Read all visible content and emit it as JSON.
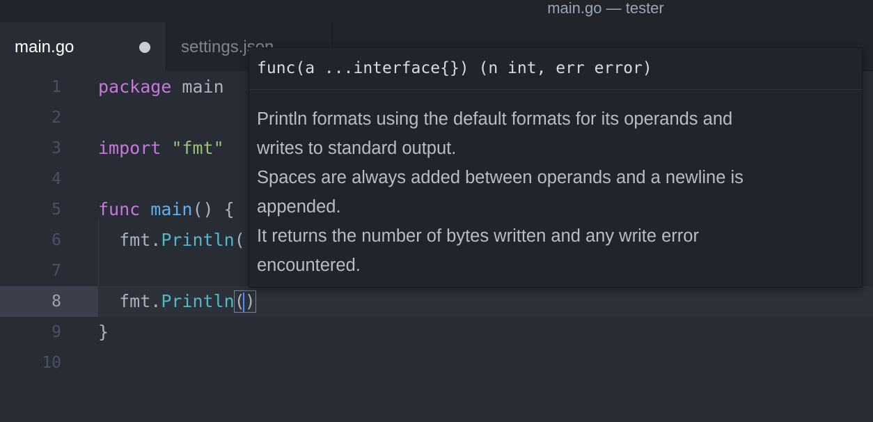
{
  "window": {
    "title": "main.go — tester"
  },
  "tabs": [
    {
      "label": "main.go",
      "modified": true,
      "active": true
    },
    {
      "label": "settings.json",
      "active": false
    }
  ],
  "editor": {
    "line_numbers": [
      "1",
      "2",
      "3",
      "4",
      "5",
      "6",
      "7",
      "8",
      "9",
      "10"
    ],
    "cursor_line": 8,
    "lines": {
      "l1": {
        "kw": "package",
        "rest": " main"
      },
      "l3": {
        "kw": "import",
        "str": "\"fmt\""
      },
      "l5": {
        "kw": "func",
        "fn": "main",
        "rest": "() {"
      },
      "l6": {
        "pkg": "  fmt.",
        "method": "Println",
        "rest": "("
      },
      "l8": {
        "pkg": "  fmt.",
        "method": "Println",
        "open": "(",
        "close": ")"
      },
      "l9": {
        "rest": "}"
      }
    }
  },
  "signature_help": {
    "signature": "func(a ...interface{}) (n int, err error)",
    "doc_lines": [
      "Println formats using the default formats for its operands and",
      "writes to standard output.",
      "Spaces are always added between operands and a newline is",
      "appended.",
      "It returns the number of bytes written and any write error",
      "encountered."
    ]
  },
  "colors": {
    "keyword": "#c678dd",
    "string": "#98c379",
    "function": "#61afef",
    "method": "#56b6c2",
    "background": "#282c34"
  }
}
